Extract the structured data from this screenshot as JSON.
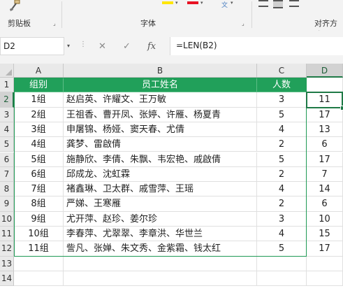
{
  "ribbon": {
    "groups": [
      {
        "label": "剪贴板"
      },
      {
        "label": "字体"
      },
      {
        "label": "对齐方式"
      }
    ]
  },
  "formula_bar": {
    "name_box": "D2",
    "cancel_icon": "✕",
    "enter_icon": "✓",
    "fx_label": "fx",
    "formula": "=LEN(B2)"
  },
  "columns": [
    "A",
    "B",
    "C",
    "D"
  ],
  "row_numbers": [
    "1",
    "2",
    "3",
    "4",
    "5",
    "6",
    "7",
    "8",
    "9",
    "10",
    "11",
    "12",
    "13",
    "14"
  ],
  "table": {
    "headers": [
      "组别",
      "员工姓名",
      "人数",
      ""
    ],
    "rows": [
      {
        "a": "1组",
        "b": "赵启英、许耀文、王万敏",
        "c": "3",
        "d": "11"
      },
      {
        "a": "2组",
        "b": "王祖香、曹开凤、张婷、许雁、杨夏青",
        "c": "5",
        "d": "17"
      },
      {
        "a": "3组",
        "b": "申屠锦、杨娅、窦天春、尤倩",
        "c": "4",
        "d": "13"
      },
      {
        "a": "4组",
        "b": "龚梦、雷啟倩",
        "c": "2",
        "d": "6"
      },
      {
        "a": "5组",
        "b": "施静欣、李倩、朱飘、韦宏艳、戚啟倩",
        "c": "5",
        "d": "17"
      },
      {
        "a": "6组",
        "b": "邱成龙、沈虹霖",
        "c": "2",
        "d": "7"
      },
      {
        "a": "7组",
        "b": "褚鑫琳、卫太群、戚雪萍、王瑶",
        "c": "4",
        "d": "14"
      },
      {
        "a": "8组",
        "b": "严娣、王寒雁",
        "c": "2",
        "d": "6"
      },
      {
        "a": "9组",
        "b": "尤开萍、赵珍、姜尔珍",
        "c": "3",
        "d": "10"
      },
      {
        "a": "10组",
        "b": "李春萍、尤翠翠、李章洪、华世兰",
        "c": "4",
        "d": "15"
      },
      {
        "a": "11组",
        "b": "訾凡、张婵、朱文秀、金紫霜、钱太红",
        "c": "5",
        "d": "17"
      }
    ]
  },
  "colors": {
    "header_fill": "#21a05a",
    "selection": "#1f7a47"
  }
}
